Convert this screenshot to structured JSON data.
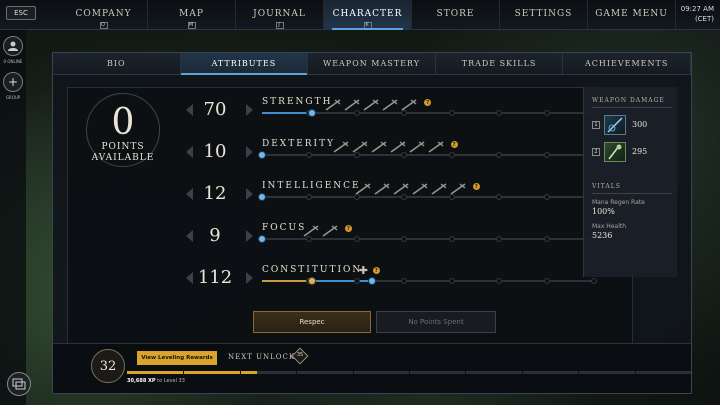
{
  "esc_label": "ESC",
  "nav": [
    {
      "label": "COMPANY",
      "key": "O"
    },
    {
      "label": "MAP",
      "key": "M"
    },
    {
      "label": "JOURNAL",
      "key": "J"
    },
    {
      "label": "CHARACTER",
      "key": "K",
      "active": true
    },
    {
      "label": "STORE",
      "key": ""
    },
    {
      "label": "SETTINGS",
      "key": ""
    },
    {
      "label": "GAME MENU",
      "key": ""
    }
  ],
  "clock": {
    "time": "09:27 AM",
    "zone": "(CET)"
  },
  "left_rail": {
    "online_label": "0 ONLINE",
    "group_label": "GROUP"
  },
  "subtabs": [
    "BIO",
    "ATTRIBUTES",
    "WEAPON MASTERY",
    "TRADE SKILLS",
    "ACHIEVEMENTS"
  ],
  "active_subtab": "ATTRIBUTES",
  "points": {
    "value": "0",
    "label_line1": "POINTS",
    "label_line2": "AVAILABLE"
  },
  "attributes": [
    {
      "name": "STRENGTH",
      "value": "70",
      "weapon_icons": [
        "sword-icon",
        "hatchet-icon",
        "war-hammer-icon",
        "great-axe-icon",
        "spear-icon"
      ],
      "progress": 0.15
    },
    {
      "name": "DEXTERITY",
      "value": "10",
      "weapon_icons": [
        "spear-icon",
        "rapier-icon",
        "bow-icon",
        "musket-icon",
        "hatchet-icon",
        "sword-icon"
      ],
      "progress": 0.0
    },
    {
      "name": "INTELLIGENCE",
      "value": "12",
      "weapon_icons": [
        "fire-staff-icon",
        "rapier-icon",
        "blunderbuss-icon",
        "ice-gauntlet-icon",
        "musket-icon",
        "rapier-icon"
      ],
      "progress": 0.0
    },
    {
      "name": "FOCUS",
      "value": "9",
      "weapon_icons": [
        "life-staff-icon",
        "void-gauntlet-icon"
      ],
      "progress": 0.0
    },
    {
      "name": "CONSTITUTION",
      "value": "112",
      "weapon_icons": [],
      "progress_gold": 0.15,
      "progress": 0.33
    }
  ],
  "side": {
    "weapon_damage_title": "WEAPON DAMAGE",
    "weapons": [
      {
        "slot": "1",
        "value": "300"
      },
      {
        "slot": "2",
        "value": "295"
      }
    ],
    "vitals_title": "VITALS",
    "mana_label": "Mana Regen Rate",
    "mana_value": "100%",
    "health_label": "Max Health",
    "health_value": "5236"
  },
  "buttons": {
    "respec": "Respec",
    "no_points": "No Points Spent"
  },
  "footer": {
    "level": "32",
    "rewards_btn": "View Leveling Rewards",
    "next_unlock": "NEXT UNLOCK",
    "unlock_level": "35",
    "xp_value": "30,688 XP",
    "xp_suffix": "to Level 33",
    "xp_progress": 0.23
  },
  "colors": {
    "accent": "#5ea3d8",
    "gold": "#d9a32c",
    "info": "#d59a2a"
  }
}
